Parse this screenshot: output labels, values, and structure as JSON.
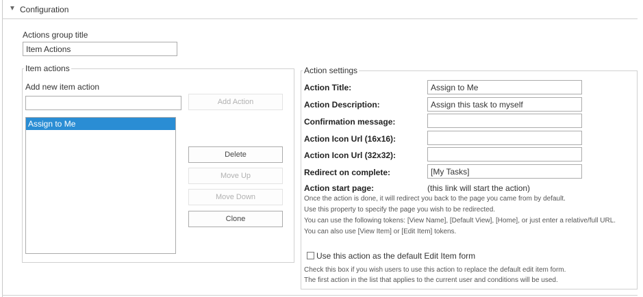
{
  "section": {
    "title": "Configuration",
    "toggle_icon": "chevron-down-icon"
  },
  "group": {
    "label": "Actions group title",
    "value": "Item Actions"
  },
  "item_actions": {
    "legend": "Item actions",
    "add_label": "Add new item action",
    "add_input_value": "",
    "add_button": "Add Action",
    "list": [
      "Assign to Me"
    ],
    "selected_index": 0,
    "buttons": {
      "delete": "Delete",
      "move_up": "Move Up",
      "move_down": "Move Down",
      "clone": "Clone"
    }
  },
  "settings": {
    "legend": "Action settings",
    "fields": {
      "title": {
        "label": "Action Title:",
        "value": "Assign to Me"
      },
      "description": {
        "label": "Action Description:",
        "value": "Assign this task to myself"
      },
      "confirmation": {
        "label": "Confirmation message:",
        "value": ""
      },
      "icon16": {
        "label": "Action Icon Url (16x16):",
        "value": ""
      },
      "icon32": {
        "label": "Action Icon Url (32x32):",
        "value": ""
      },
      "redirect": {
        "label": "Redirect on complete:",
        "value": "[My Tasks]"
      }
    },
    "start_page": {
      "label": "Action start page:",
      "value": "(this link will start the action)"
    },
    "redirect_help": [
      "Once the action is done, it will redirect you back to the page you came from by default.",
      "Use this property to specify the page you wish to be redirected.",
      "You can use the following tokens: [View Name], [Default View], [Home], or just enter a relative/full URL.",
      "You can also use [View Item] or [Edit Item] tokens."
    ],
    "default_edit": {
      "label": "Use this action as the default Edit Item form",
      "checked": false,
      "help": [
        "Check this box if you wish users to use this action to replace the default edit item form.",
        "The first action in the list that applies to the current user and conditions will be used."
      ]
    }
  }
}
